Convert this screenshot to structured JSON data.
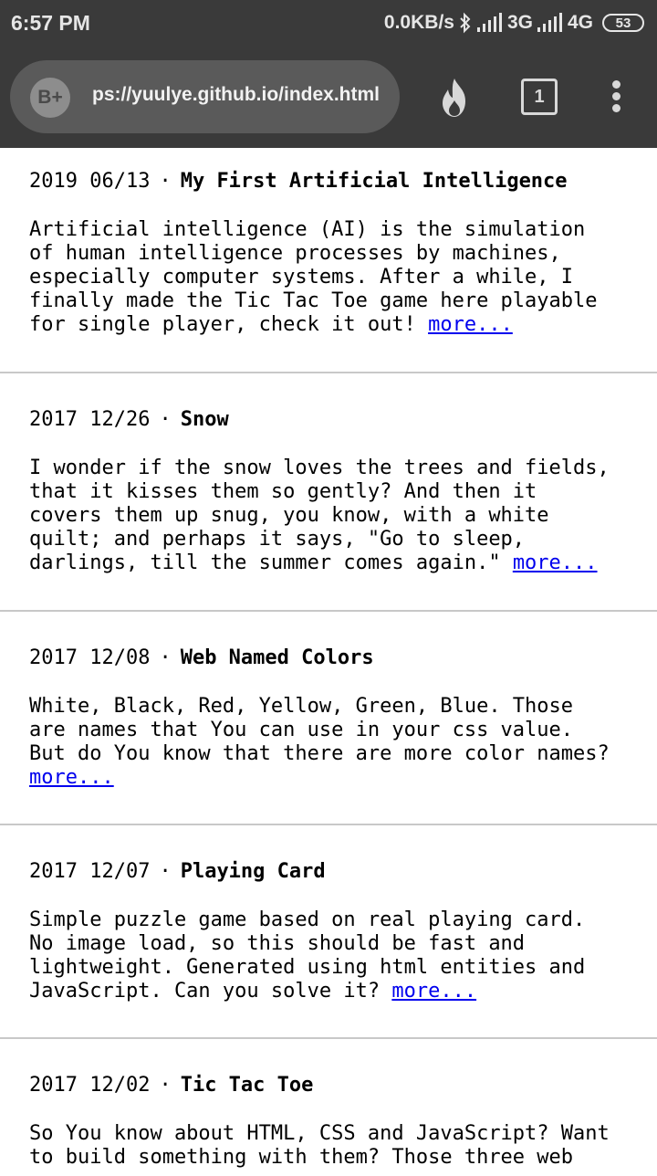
{
  "status_bar": {
    "time": "6:57 PM",
    "speed": "0.0KB/s",
    "network1": "3G",
    "network2": "4G",
    "battery": "53"
  },
  "browser": {
    "badge": "B+",
    "url": "ps://yuulye.github.io/index.html",
    "tab_count": "1"
  },
  "posts": [
    {
      "date": "2019 06/13",
      "separator": "·",
      "title": "My First Artificial Intelligence",
      "excerpt": "Artificial intelligence (AI) is the simulation\nof human intelligence processes by machines,\nespecially computer systems. After a while, I\nfinally made the Tic Tac Toe game here playable\nfor single player, check it out! ",
      "more": "more..."
    },
    {
      "date": "2017 12/26",
      "separator": "·",
      "title": "Snow",
      "excerpt": "I wonder if the snow loves the trees and fields,\nthat it kisses them so gently? And then it\ncovers them up snug, you know, with a white\nquilt; and perhaps it says, \"Go to sleep,\ndarlings, till the summer comes again.\" ",
      "more": "more..."
    },
    {
      "date": "2017 12/08",
      "separator": "·",
      "title": "Web Named Colors",
      "excerpt": "White, Black, Red, Yellow, Green, Blue. Those\nare names that You can use in your css value.\nBut do You know that there are more color names?\n",
      "more": "more..."
    },
    {
      "date": "2017 12/07",
      "separator": "·",
      "title": "Playing Card",
      "excerpt": "Simple puzzle game based on real playing card.\nNo image load, so this should be fast and\nlightweight. Generated using html entities and\nJavaScript. Can you solve it? ",
      "more": "more..."
    },
    {
      "date": "2017 12/02",
      "separator": "·",
      "title": "Tic Tac Toe",
      "excerpt": "So You know about HTML, CSS and JavaScript? Want\nto build something with them? Those three web",
      "more": ""
    }
  ]
}
